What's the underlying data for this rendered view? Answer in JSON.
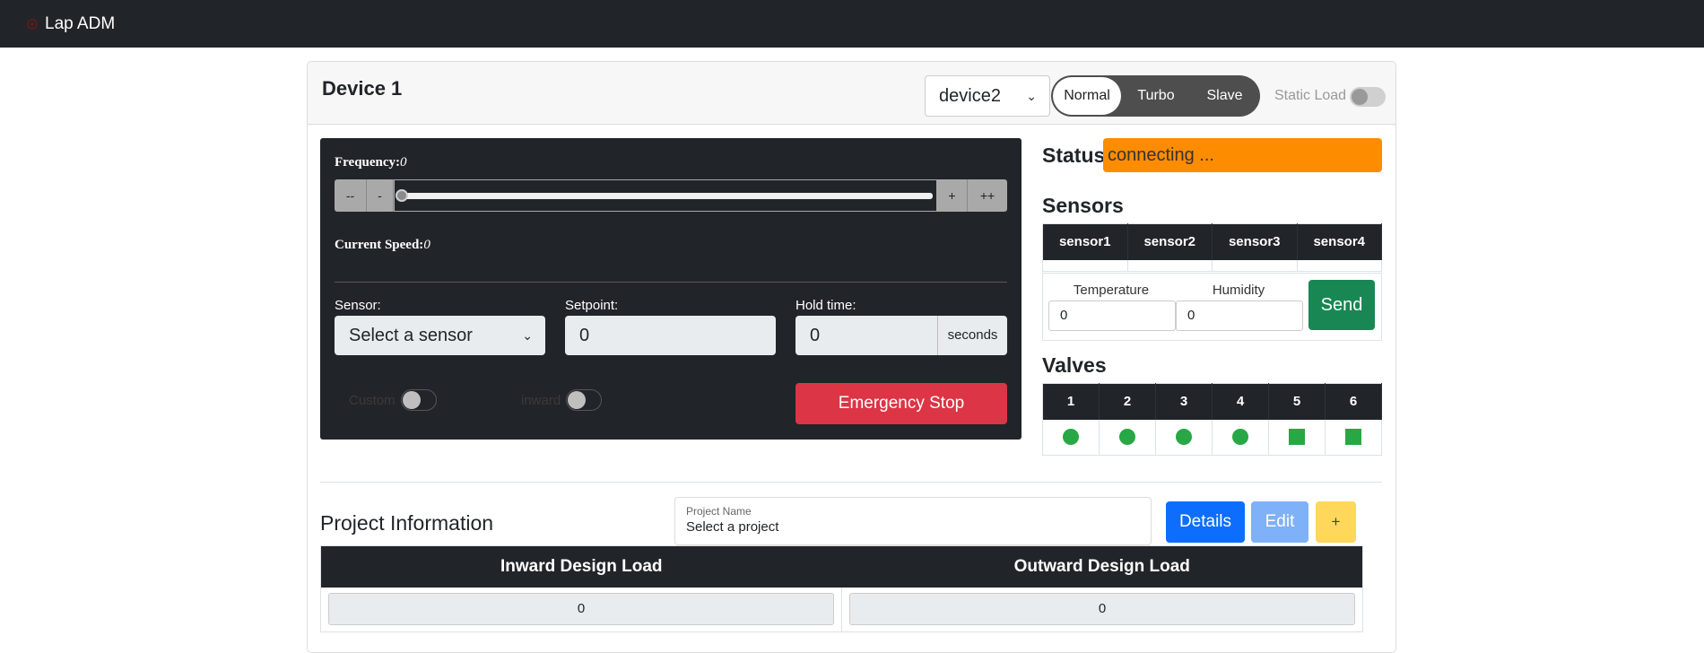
{
  "navbar": {
    "brand": "Lap ADM",
    "logo_icon": "gear-icon"
  },
  "device": {
    "title": "Device 1",
    "selected_device": "device2",
    "modes": [
      "Normal",
      "Turbo",
      "Slave"
    ],
    "active_mode": "Normal",
    "static_load_label": "Static Load",
    "static_load_on": false
  },
  "control": {
    "frequency_label": "Frequency:",
    "frequency_value": "0",
    "btn_dec_big": "--",
    "btn_dec": "-",
    "btn_inc": "+",
    "btn_inc_big": "++",
    "current_speed_label": "Current Speed:",
    "current_speed_value": "0",
    "sensor_label": "Sensor:",
    "sensor_select": "Select a sensor",
    "setpoint_label": "Setpoint:",
    "setpoint_value": "0",
    "hold_time_label": "Hold time:",
    "hold_time_value": "0",
    "hold_time_unit": "seconds",
    "custom_label": "Custom",
    "inward_label": "inward",
    "emergency_stop": "Emergency Stop"
  },
  "status": {
    "label": "Status:",
    "value": "connecting ...",
    "color": "#fd8c00"
  },
  "sensors": {
    "heading": "Sensors",
    "columns": [
      "sensor1",
      "sensor2",
      "sensor3",
      "sensor4"
    ],
    "temperature_label": "Temperature",
    "temperature_value": "0",
    "humidity_label": "Humidity",
    "humidity_value": "0",
    "send_label": "Send"
  },
  "valves": {
    "heading": "Valves",
    "columns": [
      "1",
      "2",
      "3",
      "4",
      "5",
      "6"
    ],
    "shapes": [
      "circle",
      "circle",
      "circle",
      "circle",
      "square",
      "square"
    ],
    "color": "#28a745"
  },
  "project": {
    "heading": "Project Information",
    "name_label": "Project Name",
    "name_value": "Select a project",
    "details_label": "Details",
    "edit_label": "Edit",
    "add_label": "+",
    "load_columns": [
      "Inward Design Load",
      "Outward Design Load"
    ],
    "inward_value": "0",
    "outward_value": "0"
  }
}
